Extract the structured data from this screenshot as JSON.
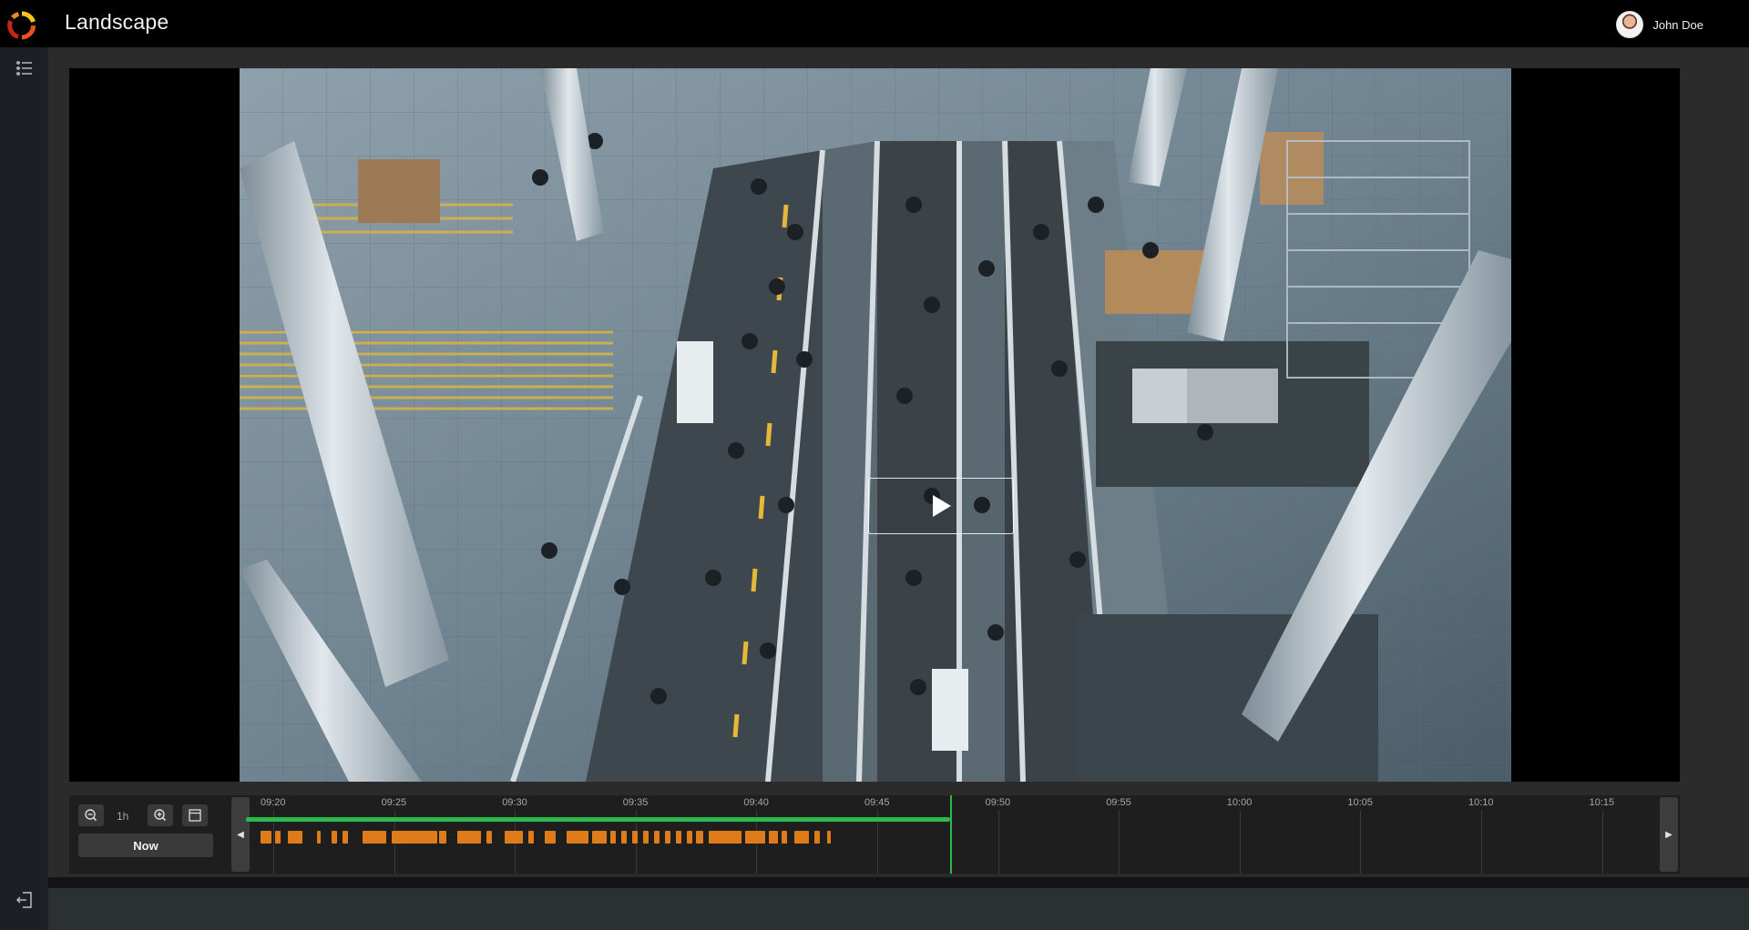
{
  "app": {
    "title": "Landscape"
  },
  "user": {
    "name": "John Doe"
  },
  "sidebar": {
    "items": [
      {
        "icon": "list-icon"
      },
      {
        "icon": "logout-icon"
      }
    ]
  },
  "player": {
    "state": "paused",
    "scene": "Overhead view of airport security checkpoint with travelers"
  },
  "timeline": {
    "range_label": "1h",
    "now_label": "Now",
    "ticks": [
      "09:20",
      "09:25",
      "09:30",
      "09:35",
      "09:40",
      "09:45",
      "09:50",
      "09:55",
      "10:00",
      "10:05",
      "10:10",
      "10:15"
    ],
    "recorded_until": "09:48",
    "colors": {
      "recorded": "#2db84d",
      "events": "#e07b1c",
      "cursor": "#2db84d"
    }
  }
}
